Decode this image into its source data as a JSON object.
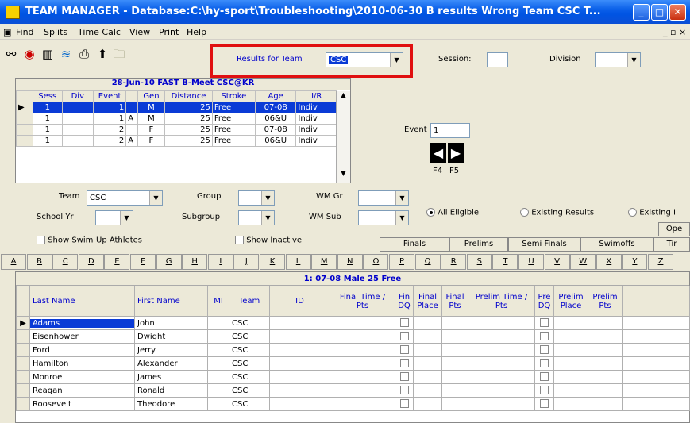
{
  "window": {
    "title": "TEAM MANAGER - Database:C:\\hy-sport\\Troubleshooting\\2010-06-30 B results Wrong Team CSC T..."
  },
  "menu": [
    "Find",
    "Splits",
    "Time Calc",
    "View",
    "Print",
    "Help"
  ],
  "results_for_team": {
    "label": "Results for Team",
    "value": "CSC"
  },
  "session": {
    "label": "Session:",
    "value": ""
  },
  "division": {
    "label": "Division",
    "value": ""
  },
  "meet_title": "28-Jun-10  FAST B-Meet CSC@KR",
  "events_table": {
    "headers": [
      "Sess",
      "Div",
      "Event",
      "",
      "Gen",
      "Distance",
      "Stroke",
      "Age",
      "I/R"
    ],
    "rows": [
      [
        "1",
        "",
        "1",
        "",
        "M",
        "25",
        "Free",
        "07-08",
        "Indiv"
      ],
      [
        "1",
        "",
        "1",
        "A",
        "M",
        "25",
        "Free",
        "06&U",
        "Indiv"
      ],
      [
        "1",
        "",
        "2",
        "",
        "F",
        "25",
        "Free",
        "07-08",
        "Indiv"
      ],
      [
        "1",
        "",
        "2",
        "A",
        "F",
        "25",
        "Free",
        "06&U",
        "Indiv"
      ]
    ]
  },
  "event_nav": {
    "label": "Event",
    "value": "1",
    "keys": [
      "F4",
      "F5"
    ]
  },
  "filters": {
    "team_label": "Team",
    "team_value": "CSC",
    "group_label": "Group",
    "wm_gr_label": "WM Gr",
    "school_yr_label": "School Yr",
    "subgroup_label": "Subgroup",
    "wm_sub_label": "WM Sub",
    "all_eligible": "All Eligible",
    "existing_results": "Existing Results",
    "existing_i": "Existing I",
    "show_swim_up": "Show Swim-Up Athletes",
    "show_inactive": "Show Inactive",
    "ope": "Ope",
    "tir": "Tir"
  },
  "tabs": [
    "Finals",
    "Prelims",
    "Semi Finals",
    "Swimoffs"
  ],
  "alphabet": [
    "A",
    "B",
    "C",
    "D",
    "E",
    "F",
    "G",
    "H",
    "I",
    "J",
    "K",
    "L",
    "M",
    "N",
    "O",
    "P",
    "Q",
    "R",
    "S",
    "T",
    "U",
    "V",
    "W",
    "X",
    "Y",
    "Z"
  ],
  "event_header": "1: 07-08  Male 25  Free",
  "results_table": {
    "headers": [
      "Last Name",
      "First Name",
      "MI",
      "Team",
      "ID",
      "Final Time / Pts",
      "Fin DQ",
      "Final Place",
      "Final Pts",
      "Prelim Time / Pts",
      "Pre DQ",
      "Prelim Place",
      "Prelim Pts"
    ],
    "rows": [
      [
        "Adams",
        "John",
        "",
        "CSC"
      ],
      [
        "Eisenhower",
        "Dwight",
        "",
        "CSC"
      ],
      [
        "Ford",
        "Jerry",
        "",
        "CSC"
      ],
      [
        "Hamilton",
        "Alexander",
        "",
        "CSC"
      ],
      [
        "Monroe",
        "James",
        "",
        "CSC"
      ],
      [
        "Reagan",
        "Ronald",
        "",
        "CSC"
      ],
      [
        "Roosevelt",
        "Theodore",
        "",
        "CSC"
      ]
    ]
  }
}
